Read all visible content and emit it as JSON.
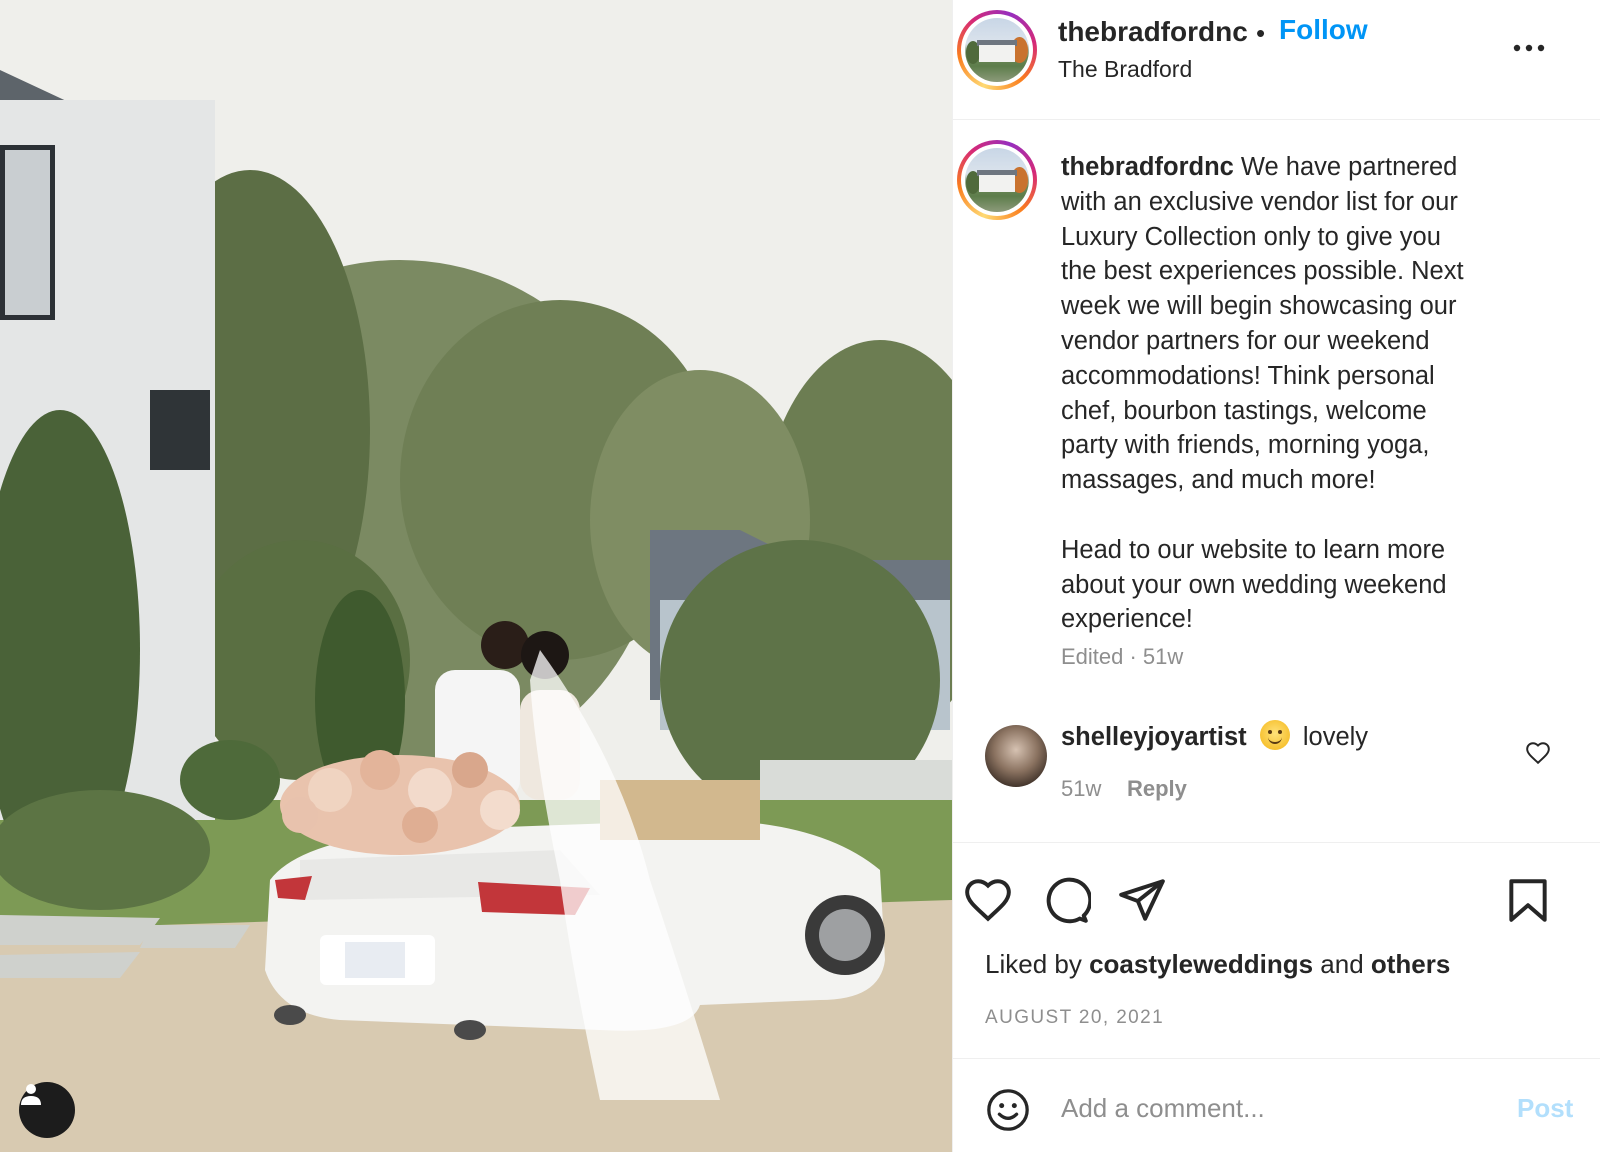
{
  "post": {
    "image_alt": "Couple on a white convertible with flowers in front of The Bradford",
    "user_tag_icon": "person-icon"
  },
  "header": {
    "username": "thebradfordnc",
    "separator": "•",
    "follow_label": "Follow",
    "location": "The Bradford",
    "more_icon": "more-horizontal-icon"
  },
  "caption": {
    "username": "thebradfordnc",
    "text": " We have partnered\nwith an exclusive vendor list for our\nLuxury Collection only to give you\nthe best experiences possible. Next\nweek we will begin showcasing our\nvendor partners for our weekend\naccommodations! Think personal\nchef, bourbon tastings, welcome\nparty with friends, morning yoga,\nmassages, and much more!\n\nHead to our website to learn more\nabout your own wedding weekend\nexperience!",
    "meta": "Edited · 51w"
  },
  "comment": {
    "username": "shelleyjoyartist",
    "emoji": "smiling-face-emoji",
    "text": "lovely",
    "time": "51w",
    "reply_label": "Reply",
    "like_icon": "heart-icon"
  },
  "actions": {
    "like_icon": "heart-icon",
    "comment_icon": "comment-icon",
    "share_icon": "paper-plane-icon",
    "save_icon": "bookmark-icon",
    "liked_by_prefix": "Liked by ",
    "liked_by_user": "coastyleweddings",
    "liked_by_and": " and ",
    "liked_by_others": "others",
    "date": "AUGUST 20, 2021"
  },
  "add_comment": {
    "emoji_icon": "smiley-icon",
    "placeholder": "Add a comment...",
    "post_label": "Post"
  },
  "colors": {
    "link_blue": "#0095f6",
    "post_disabled": "#b2dffc",
    "secondary_text": "#8e8e8e",
    "primary_text": "#262626",
    "divider": "#efefef"
  }
}
